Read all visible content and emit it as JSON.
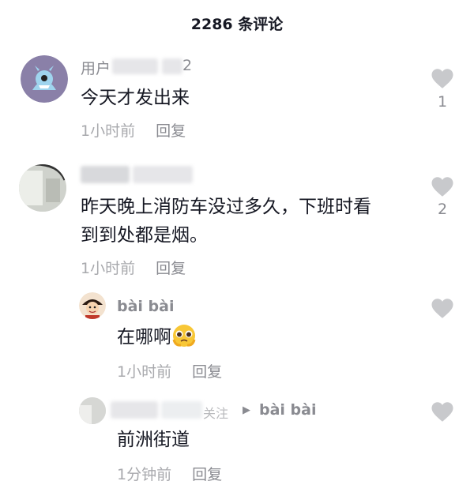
{
  "header": {
    "title": "2286 条评论"
  },
  "comments": [
    {
      "username": "用户",
      "username_tail": "2",
      "text": "今天才发出来",
      "time": "1小时前",
      "reply_label": "回复",
      "likes": "1"
    },
    {
      "text_line1": "昨天晚上消防车没过多久，下班时看",
      "text_line2": "到到处都是烟。",
      "time": "1小时前",
      "reply_label": "回复",
      "likes": "2",
      "replies": [
        {
          "username": "bài bài",
          "text": "在哪啊",
          "emoji": "pleading-face-icon",
          "time": "1小时前",
          "reply_label": "回复"
        },
        {
          "reply_to_partial": "关注",
          "reply_to": "bài bài",
          "text": "前洲街道",
          "time": "1分钟前",
          "reply_label": "回复"
        }
      ]
    }
  ],
  "colors": {
    "heart": "#c8c9cc",
    "text": "#161823",
    "meta": "#a8a9ad"
  }
}
